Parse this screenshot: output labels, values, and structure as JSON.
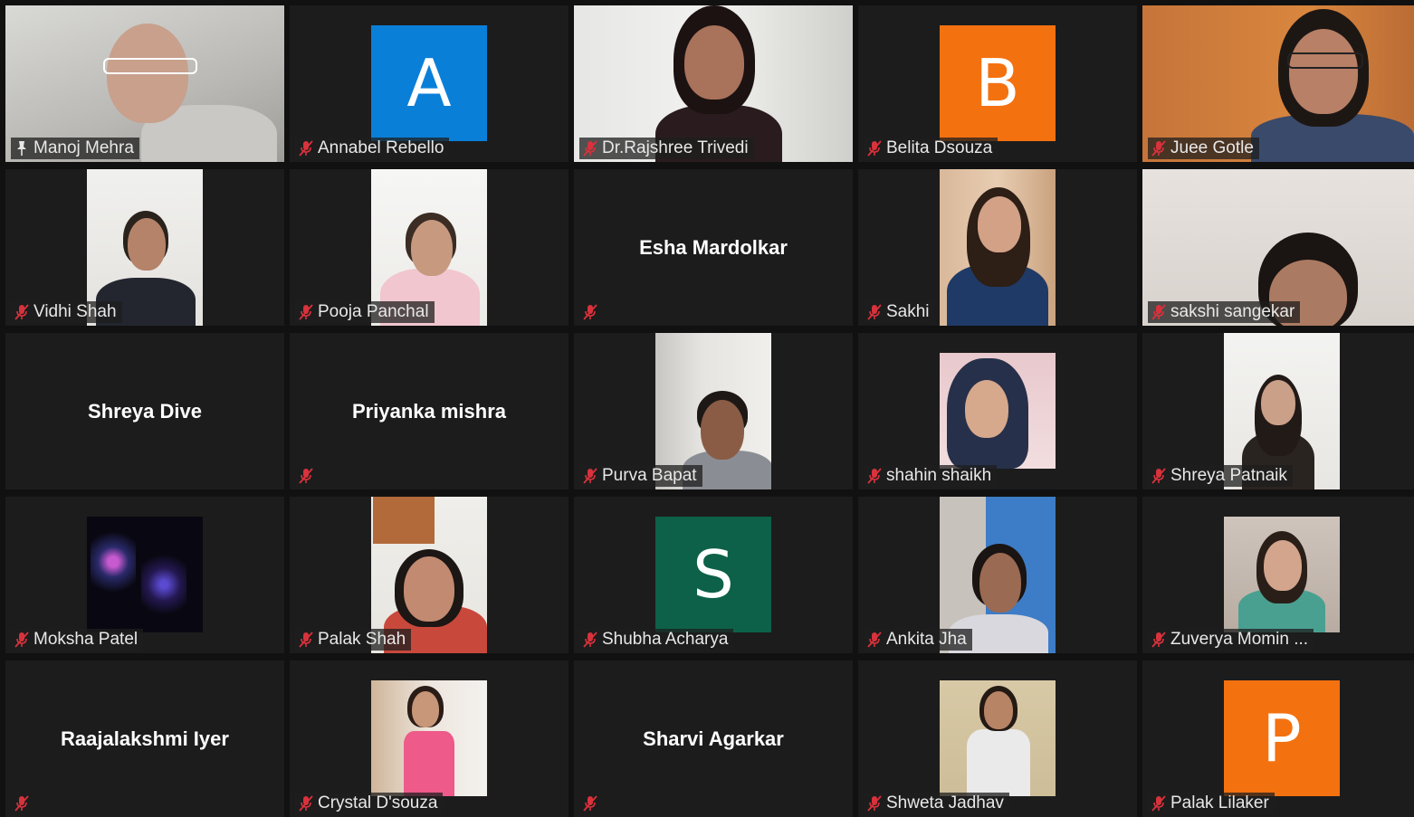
{
  "participants": [
    {
      "name": "Manoj Mehra",
      "kind": "video",
      "active": true,
      "pinned": true
    },
    {
      "name": "Annabel Rebello",
      "kind": "avatar",
      "initial": "A",
      "color": "#0a7fd8"
    },
    {
      "name": "Dr.Rajshree Trivedi",
      "kind": "video"
    },
    {
      "name": "Belita Dsouza",
      "kind": "avatar",
      "initial": "B",
      "color": "#f47110"
    },
    {
      "name": "Juee Gotle",
      "kind": "video"
    },
    {
      "name": "Vidhi Shah",
      "kind": "video"
    },
    {
      "name": "Pooja Panchal",
      "kind": "video"
    },
    {
      "name": "Esha Mardolkar",
      "kind": "name"
    },
    {
      "name": "Sakhi",
      "kind": "video"
    },
    {
      "name": "sakshi sangekar",
      "kind": "video"
    },
    {
      "name": "Shreya Dive",
      "kind": "name-only"
    },
    {
      "name": "Priyanka mishra",
      "kind": "name"
    },
    {
      "name": "Purva Bapat",
      "kind": "video"
    },
    {
      "name": "shahin shaikh",
      "kind": "video"
    },
    {
      "name": "Shreya Patnaik",
      "kind": "video"
    },
    {
      "name": "Moksha Patel",
      "kind": "video"
    },
    {
      "name": "Palak Shah",
      "kind": "video"
    },
    {
      "name": "Shubha Acharya",
      "kind": "avatar",
      "initial": "S",
      "color": "#0d6148"
    },
    {
      "name": "Ankita Jha",
      "kind": "video"
    },
    {
      "name": "Zuverya Momin ...",
      "kind": "video"
    },
    {
      "name": "Raajalakshmi Iyer",
      "kind": "name"
    },
    {
      "name": "Crystal D'souza",
      "kind": "video"
    },
    {
      "name": "Sharvi Agarkar",
      "kind": "name"
    },
    {
      "name": "Shweta Jadhav",
      "kind": "video"
    },
    {
      "name": "Palak Lilaker",
      "kind": "avatar",
      "initial": "P",
      "color": "#f47110"
    }
  ],
  "icons": {
    "muted": "muted-mic-icon",
    "pin": "pin-icon"
  },
  "colors": {
    "tile_bg": "#1c1c1c",
    "active_border": "#cfe66b",
    "muted_red": "#d8323c"
  }
}
